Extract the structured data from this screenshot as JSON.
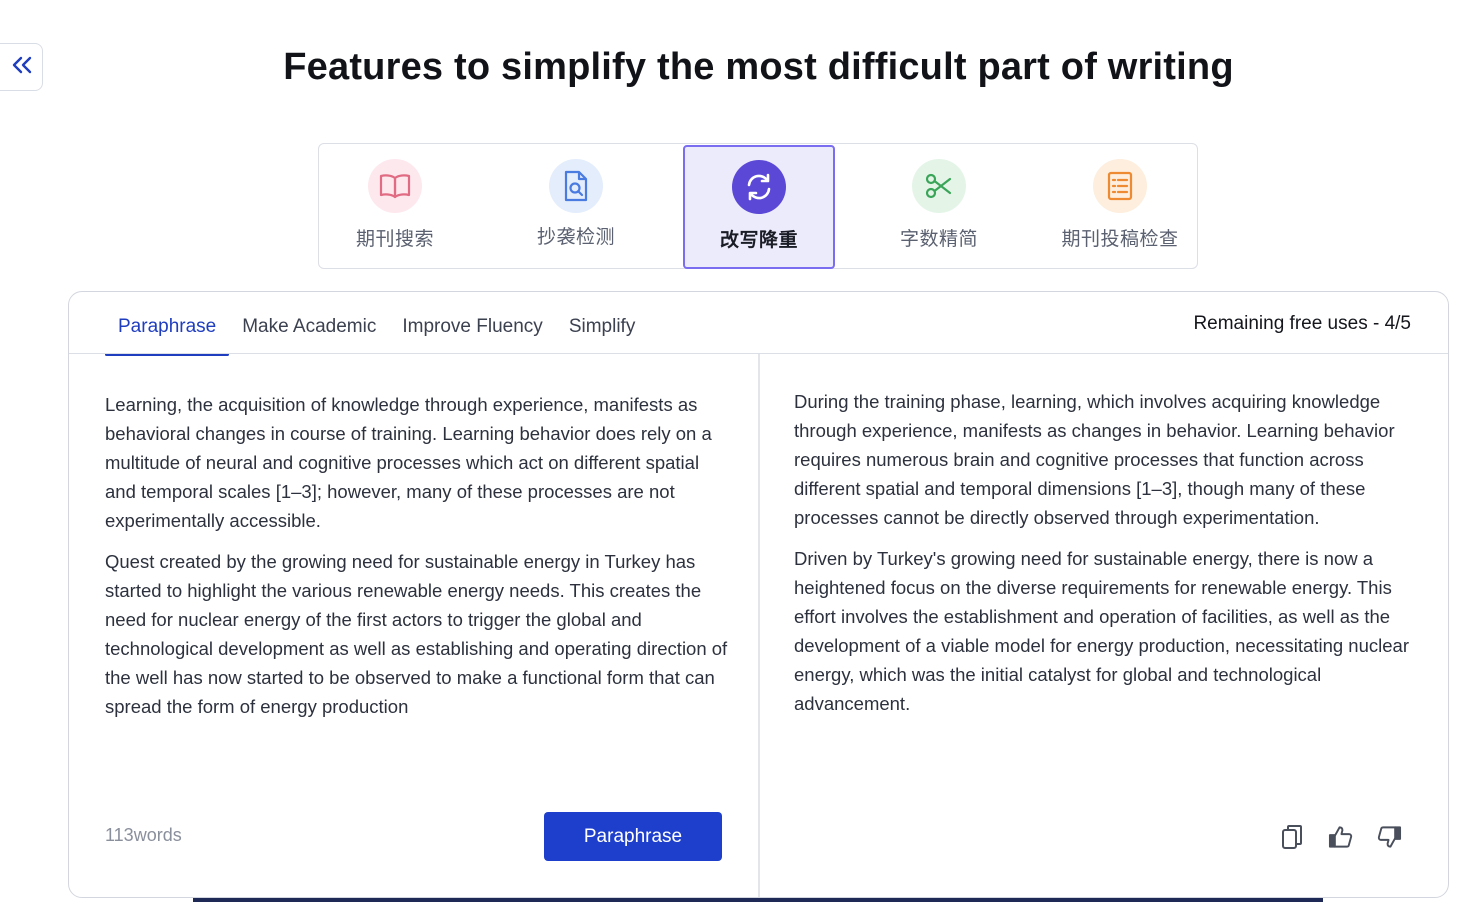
{
  "page": {
    "title": "Features to simplify the most difficult part of writing"
  },
  "features": [
    {
      "label": "期刊搜索",
      "icon": "book-icon",
      "color": "#e06b82",
      "bg": "#fde8ee",
      "active": false
    },
    {
      "label": "抄袭检测",
      "icon": "document-search-icon",
      "color": "#4a7be0",
      "bg": "#e4edfc",
      "active": false
    },
    {
      "label": "改写降重",
      "icon": "refresh-icon",
      "color": "#ffffff",
      "bg": "#5b48d6",
      "active": true
    },
    {
      "label": "字数精简",
      "icon": "scissors-icon",
      "color": "#3aa558",
      "bg": "#e4f5e8",
      "active": false
    },
    {
      "label": "期刊投稿检查",
      "icon": "checklist-icon",
      "color": "#ee8a32",
      "bg": "#fdeede",
      "active": false
    }
  ],
  "editor": {
    "tabs": [
      "Paraphrase",
      "Make Academic",
      "Improve Fluency",
      "Simplify"
    ],
    "active_tab": "Paraphrase",
    "remaining": "Remaining free uses - 4/5",
    "input_paragraphs": [
      "Learning, the acquisition of knowledge through experience, manifests as behavioral changes in course of training. Learning behavior does rely on a multitude of neural and cognitive processes which act on different spatial and temporal scales [1–3]; however, many of these processes are not experimentally accessible.",
      "Quest created by the growing need for sustainable energy in Turkey has started to highlight the various renewable energy needs. This creates the need for nuclear energy of the first actors to trigger the global and technological development as well as establishing and operating direction of the well has now started to be observed to make a functional form that can spread the form of energy production"
    ],
    "output_paragraphs": [
      "During the training phase, learning, which involves acquiring knowledge through experience, manifests as changes in behavior. Learning behavior requires numerous brain and cognitive processes that function across different spatial and temporal dimensions [1–3], though many of these processes cannot be directly observed through experimentation.",
      "Driven by Turkey's growing need for sustainable energy, there is now a heightened focus on the diverse requirements for renewable energy. This effort involves the establishment and operation of facilities, as well as the development of a viable model for energy production, necessitating nuclear energy, which was the initial catalyst for global and technological advancement."
    ],
    "word_count": "113words",
    "paraphrase_button": "Paraphrase",
    "actions": [
      "copy-icon",
      "thumbs-up-icon",
      "thumbs-down-icon"
    ]
  },
  "colors": {
    "accent": "#1d3fcc",
    "active_feature_bg": "#ecebfb",
    "active_feature_border": "#7a6df0"
  }
}
